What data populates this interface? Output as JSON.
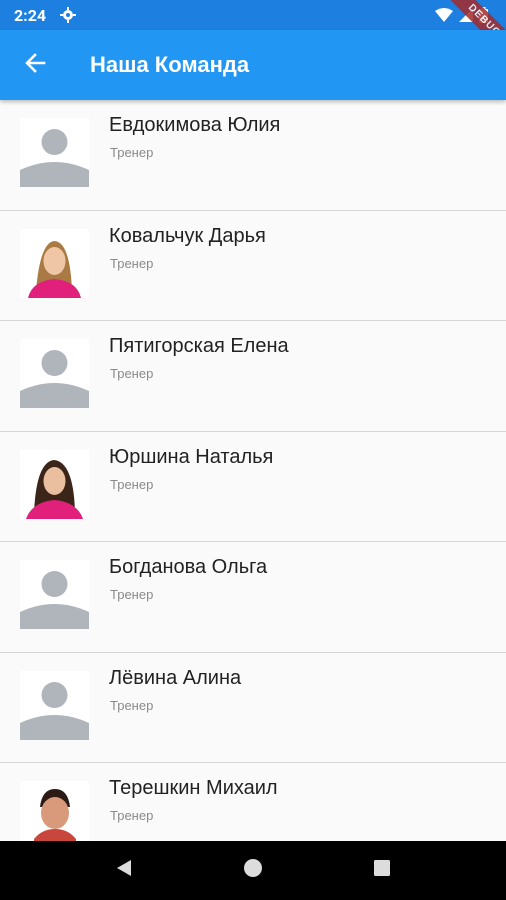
{
  "status_bar": {
    "time": "2:24",
    "debug_label": "DEBUG"
  },
  "app_bar": {
    "title": "Наша Команда"
  },
  "members": [
    {
      "name": "Евдокимова Юлия",
      "role": "Тренер",
      "avatar": "placeholder"
    },
    {
      "name": "Ковальчук Дарья",
      "role": "Тренер",
      "avatar": "photo-woman-blonde"
    },
    {
      "name": "Пятигорская Елена",
      "role": "Тренер",
      "avatar": "placeholder"
    },
    {
      "name": "Юршина Наталья",
      "role": "Тренер",
      "avatar": "photo-woman-brunette"
    },
    {
      "name": "Богданова Ольга",
      "role": "Тренер",
      "avatar": "placeholder"
    },
    {
      "name": "Лёвина Алина",
      "role": "Тренер",
      "avatar": "placeholder"
    },
    {
      "name": "Терешкин Михаил",
      "role": "Тренер",
      "avatar": "photo-man"
    }
  ],
  "colors": {
    "status_bar": "#1d7fe0",
    "app_bar": "#2196f3",
    "accent_pink": "#e0207a"
  }
}
